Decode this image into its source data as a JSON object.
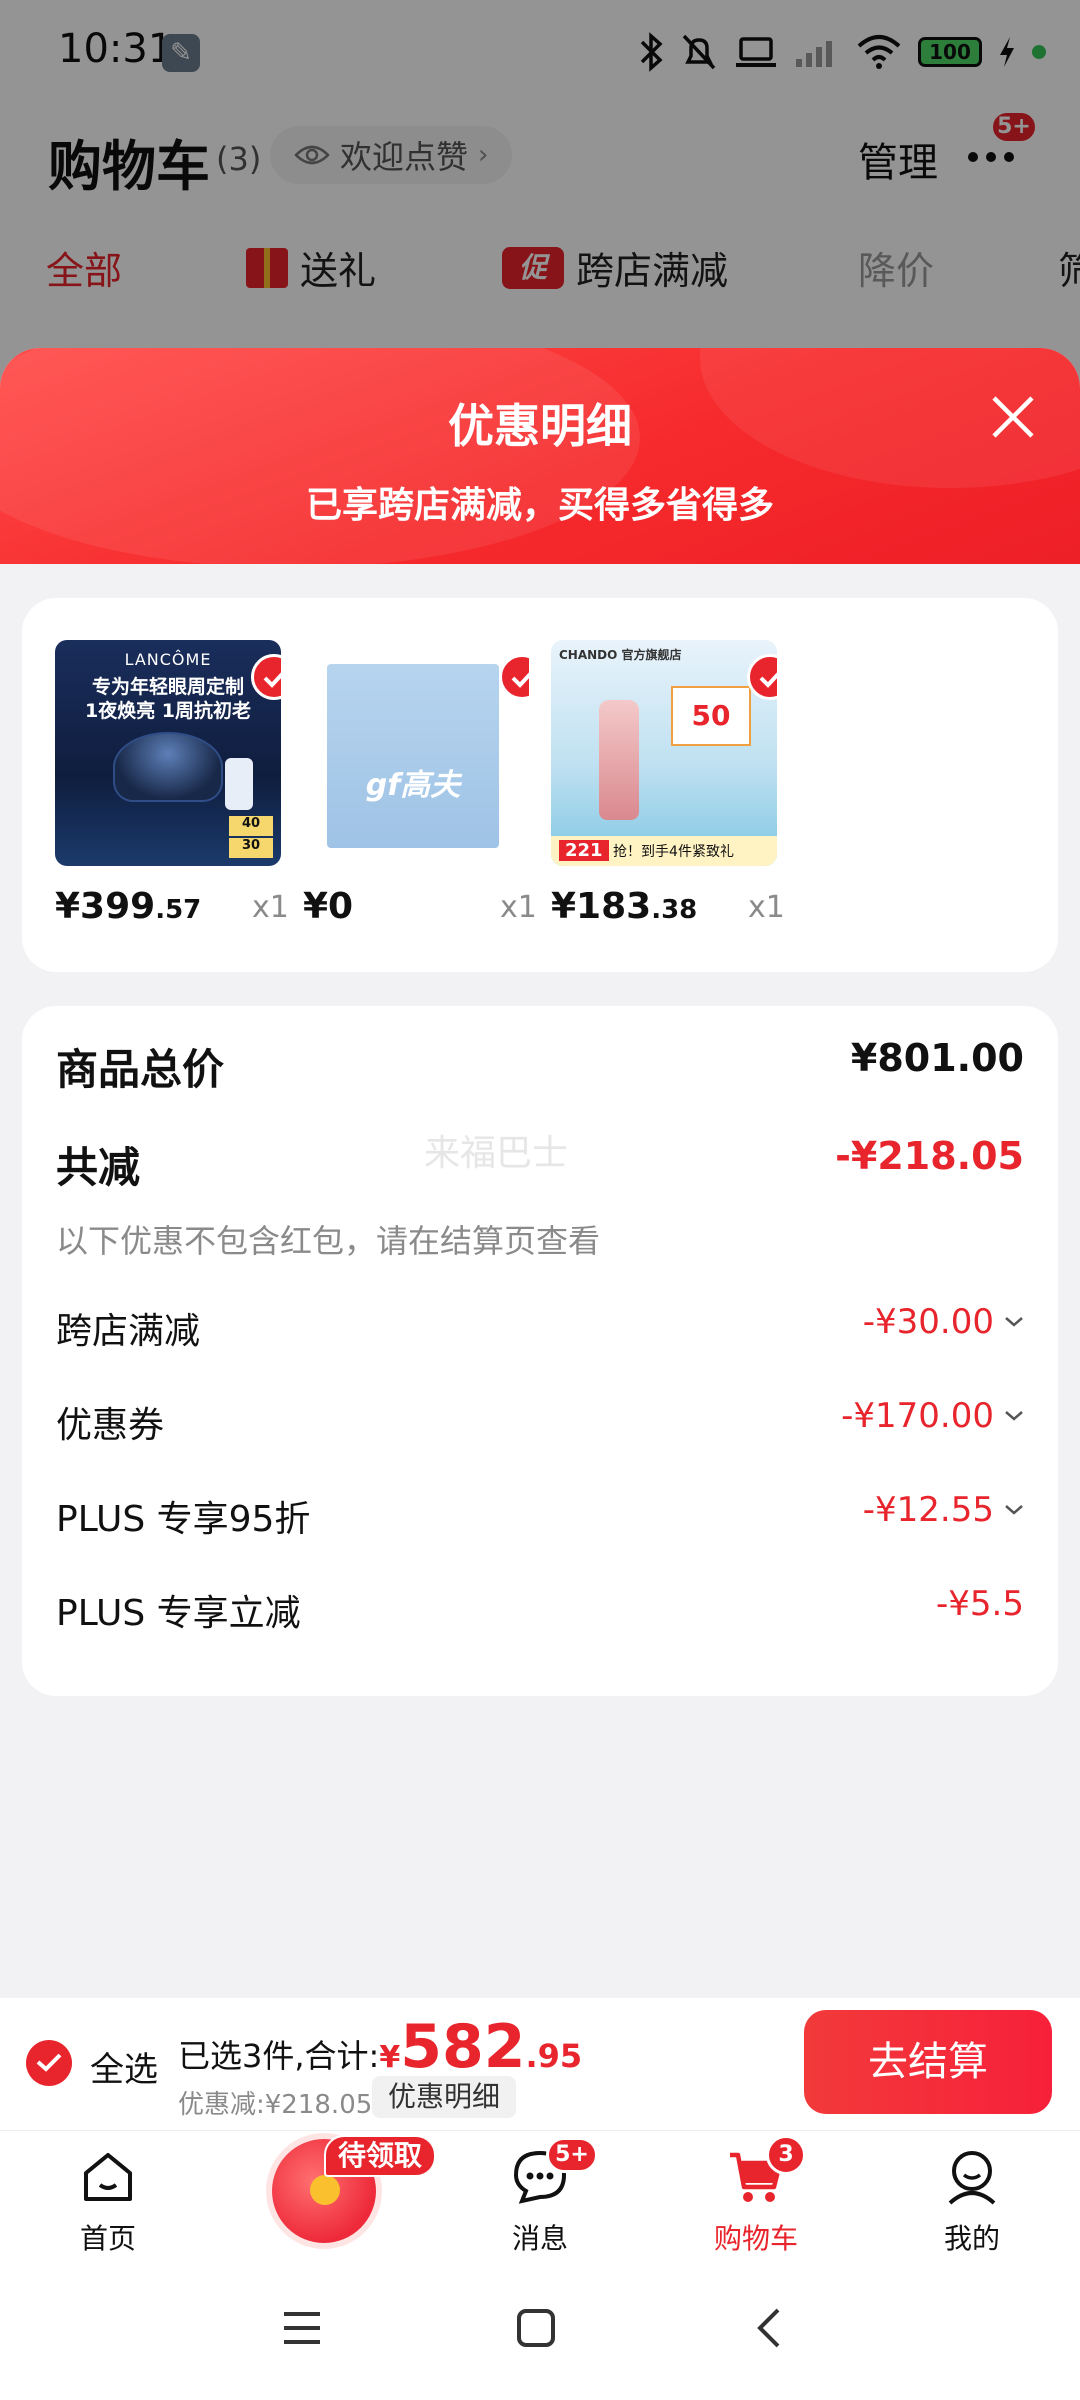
{
  "status_bar": {
    "time": "10:31",
    "battery": "100"
  },
  "cart_header": {
    "title": "购物车",
    "count": "(3)",
    "welcome": "欢迎点赞",
    "manage": "管理",
    "more_badge": "5+"
  },
  "filter_tabs": {
    "all": "全部",
    "gift": "送礼",
    "promo_icon": "促",
    "cross_store": "跨店满减",
    "price_drop": "降价",
    "filter": "筛"
  },
  "sheet": {
    "title": "优惠明细",
    "subtitle": "已享跨店满减，买得多省得多",
    "products": [
      {
        "price_main": "¥399",
        "price_dec": ".57",
        "qty": "x1",
        "image": "lancome-eye-cream",
        "img_brand": "LANCÔME",
        "img_line1": "专为年轻眼周定制",
        "img_line2": "1夜焕亮 1周抗初老",
        "img_tag_a": "40",
        "img_tag_b": "30"
      },
      {
        "price_main": "¥0",
        "price_dec": "",
        "qty": "x1",
        "image": "gf-facial-mask",
        "img_logo": "gf高夫"
      },
      {
        "price_main": "¥183",
        "price_dec": ".38",
        "qty": "x1",
        "image": "chando-serum",
        "img_shop": "CHANDO 官方旗舰店",
        "img_badge": "50",
        "img_price": "221",
        "img_strip": "抢！到手4件紧致礼"
      }
    ],
    "totals": {
      "subtotal_label": "商品总价",
      "subtotal_value": "¥801.00",
      "discount_label": "共减",
      "discount_value": "-¥218.05",
      "note": "以下优惠不包含红包，请在结算页查看",
      "watermark": "来福巴士",
      "items": [
        {
          "label": "跨店满减",
          "value": "-¥30.00"
        },
        {
          "label": "优惠券",
          "value": "-¥170.00"
        },
        {
          "label": "PLUS 专享95折",
          "value": "-¥12.55"
        },
        {
          "label": "PLUS 专享立减",
          "value": "-¥5.5"
        }
      ]
    }
  },
  "checkout": {
    "select_all": "全选",
    "summary_prefix": "已选3件,合计:",
    "yen": "¥",
    "total_main": "582",
    "total_dec": ".95",
    "saved": "优惠减:¥218.05",
    "detail_button": "优惠明细",
    "checkout_button": "去结算"
  },
  "bottom_nav": {
    "home": "首页",
    "pending": "待领取",
    "messages": "消息",
    "messages_badge": "5+",
    "cart": "购物车",
    "cart_badge": "3",
    "me": "我的"
  },
  "colors": {
    "accent": "#e8242c",
    "sheet_header": "#f62a2c",
    "background": "#f2f2f4"
  }
}
